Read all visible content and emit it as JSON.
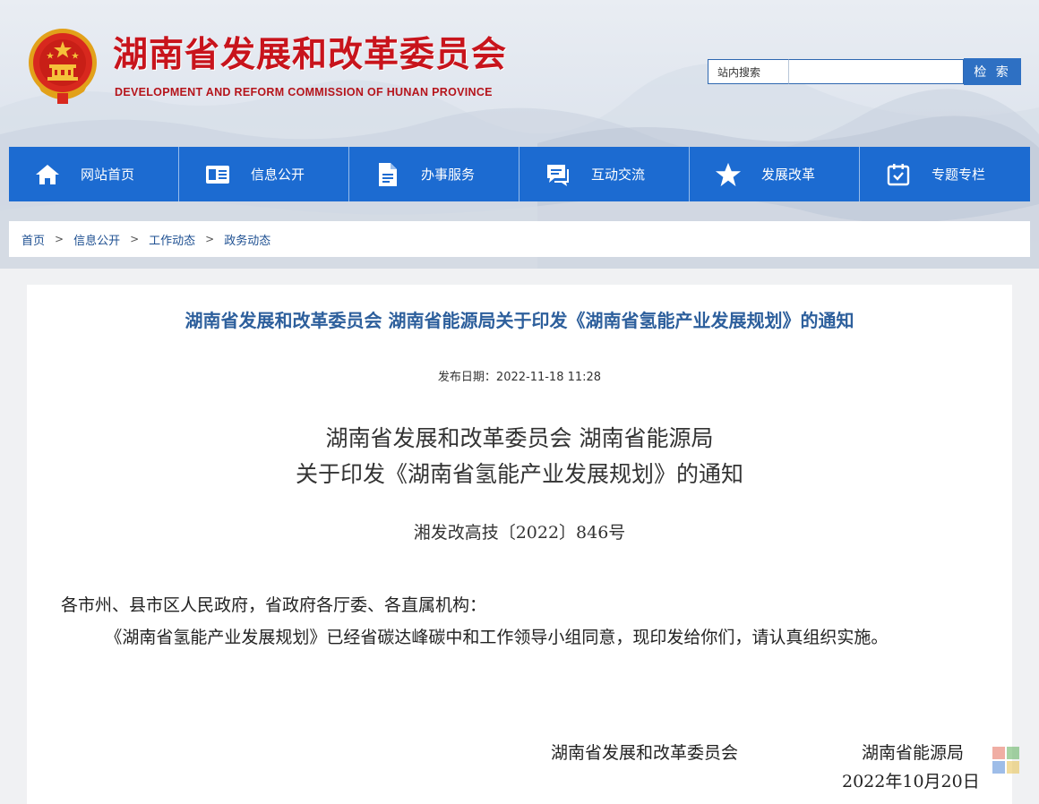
{
  "header": {
    "title": "湖南省发展和改革委员会",
    "subtitle": "DEVELOPMENT AND REFORM COMMISSION OF HUNAN PROVINCE"
  },
  "search": {
    "label": "站内搜索",
    "placeholder": "",
    "button": "检 索"
  },
  "nav": {
    "items": [
      {
        "label": "网站首页",
        "icon": "home-icon"
      },
      {
        "label": "信息公开",
        "icon": "id-card-icon"
      },
      {
        "label": "办事服务",
        "icon": "document-icon"
      },
      {
        "label": "互动交流",
        "icon": "chat-icon"
      },
      {
        "label": "发展改革",
        "icon": "star-icon"
      },
      {
        "label": "专题专栏",
        "icon": "calendar-icon"
      }
    ]
  },
  "breadcrumb": [
    "首页",
    "信息公开",
    "工作动态",
    "政务动态"
  ],
  "breadcrumb_sep": ">",
  "article": {
    "title": "湖南省发展和改革委员会 湖南省能源局关于印发《湖南省氢能产业发展规划》的通知",
    "pub_date": "发布日期：2022-11-18 11:28",
    "doc_title_line1": "湖南省发展和改革委员会 湖南省能源局",
    "doc_title_line2": "关于印发《湖南省氢能产业发展规划》的通知",
    "doc_number": "湘发改高技〔2022〕846号",
    "salutation": "各市州、县市区人民政府，省政府各厅委、各直属机构：",
    "paragraph1": "《湖南省氢能产业发展规划》已经省碳达峰碳中和工作领导小组同意，现印发给你们，请认真组织实施。",
    "signer1": "湖南省发展和改革委员会",
    "signer2": "湖南省能源局",
    "sign_date": "2022年10月20日"
  },
  "colors": {
    "brand_red": "#c8141c",
    "nav_blue": "#1c6bd1",
    "title_blue": "#2d5f9c"
  }
}
